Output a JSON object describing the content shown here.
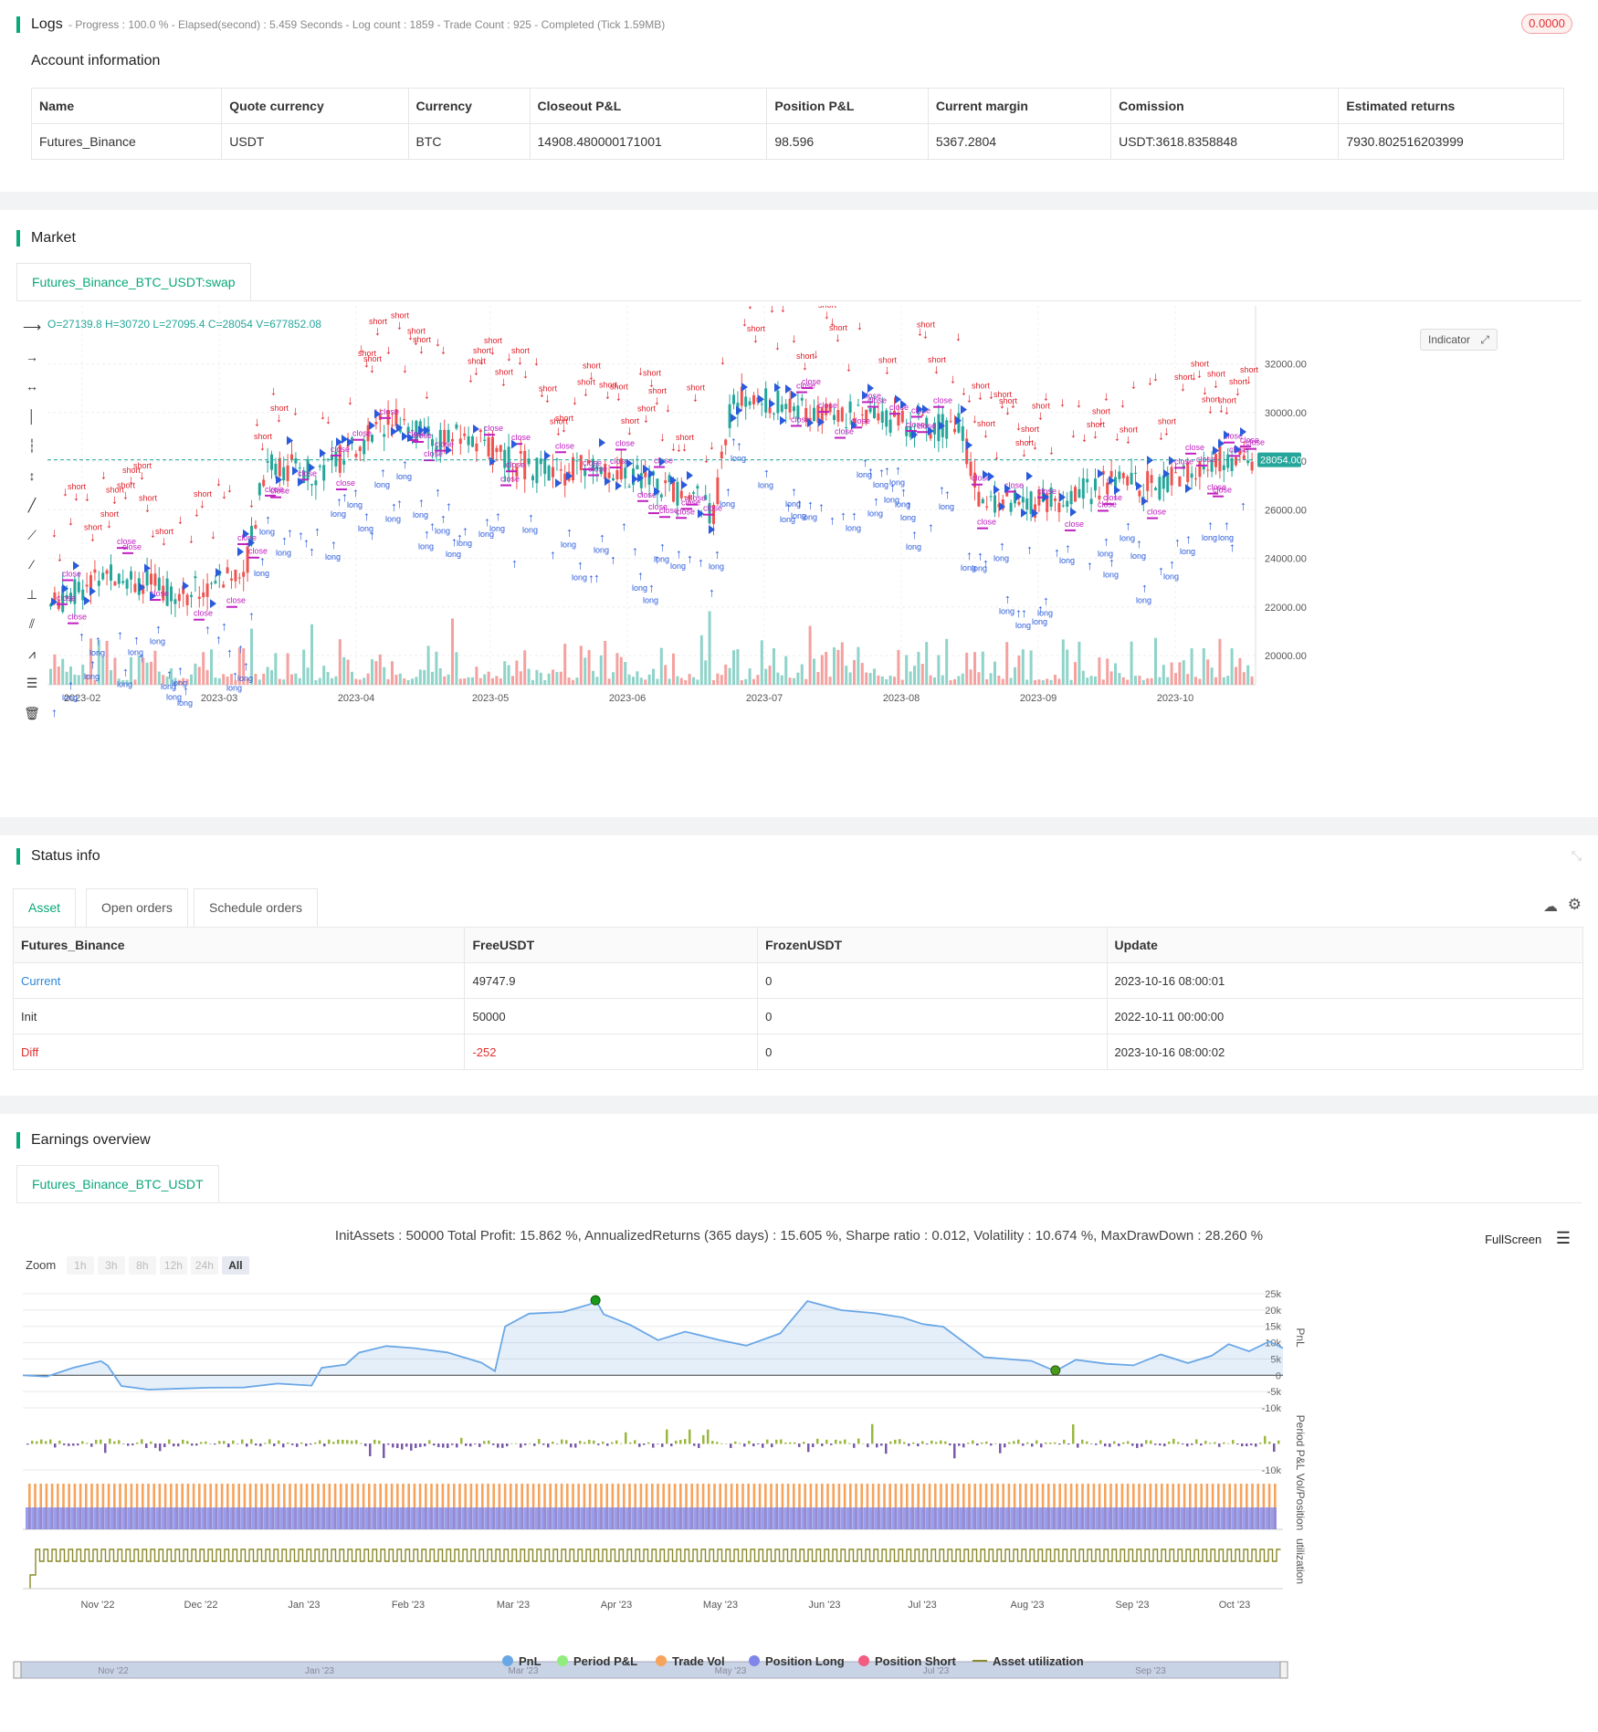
{
  "logs": {
    "title": "Logs",
    "summary": "- Progress : 100.0 % - Elapsed(second) : 5.459 Seconds - Log count : 1859 - Trade Count : 925 - Completed (Tick 1.59MB)",
    "badge": "0.0000"
  },
  "account": {
    "heading": "Account information",
    "columns": [
      "Name",
      "Quote currency",
      "Currency",
      "Closeout P&L",
      "Position P&L",
      "Current margin",
      "Comission",
      "Estimated returns"
    ],
    "row": [
      "Futures_Binance",
      "USDT",
      "BTC",
      "14908.480000171001",
      "98.596",
      "5367.2804",
      "USDT:3618.8358848",
      "7930.802516203999"
    ]
  },
  "market": {
    "title": "Market",
    "tab": "Futures_Binance_BTC_USDT:swap",
    "ohlc": "O=27139.8 H=30720 L=27095.4 C=28054 V=677852.08",
    "indicator_btn": "Indicator",
    "price_tag": "28054.00",
    "y_ticks": [
      "32000.00",
      "30000.00",
      "28000.00",
      "26000.00",
      "24000.00",
      "22000.00",
      "20000.00"
    ],
    "x_ticks": [
      "2023-02",
      "2023-03",
      "2023-04",
      "2023-05",
      "2023-06",
      "2023-07",
      "2023-08",
      "2023-09",
      "2023-10"
    ]
  },
  "status": {
    "title": "Status info",
    "tabs": [
      "Asset",
      "Open orders",
      "Schedule orders"
    ],
    "columns": [
      "Futures_Binance",
      "FreeUSDT",
      "FrozenUSDT",
      "Update"
    ],
    "rows": [
      [
        "Current",
        "49747.9",
        "0",
        "2023-10-16 08:00:01"
      ],
      [
        "Init",
        "50000",
        "0",
        "2022-10-11 00:00:00"
      ],
      [
        "Diff",
        "-252",
        "0",
        "2023-10-16 08:00:02"
      ]
    ]
  },
  "earnings": {
    "title": "Earnings overview",
    "tab": "Futures_Binance_BTC_USDT",
    "summary": "InitAssets : 50000 Total Profit: 15.862 %, AnnualizedReturns (365 days) : 15.605 %, Sharpe ratio : 0.012, Volatility : 10.674 %, MaxDrawDown : 28.260 %",
    "fullscreen": "FullScreen",
    "zoom_label": "Zoom",
    "zoom": [
      "1h",
      "3h",
      "8h",
      "12h",
      "24h",
      "All"
    ],
    "pnl_ticks": [
      "25k",
      "20k",
      "15k",
      "10k",
      "5k",
      "0",
      "-5k",
      "-10k"
    ],
    "period_tick": "-10k",
    "axis_labels": [
      "PnL",
      "Period P&L",
      "Vol/Position",
      "utilization"
    ],
    "x_ticks": [
      "Nov '22",
      "Dec '22",
      "Jan '23",
      "Feb '23",
      "Mar '23",
      "Apr '23",
      "May '23",
      "Jun '23",
      "Jul '23",
      "Aug '23",
      "Sep '23",
      "Oct '23"
    ],
    "nav_ticks": [
      "Nov '22",
      "Jan '23",
      "Mar '23",
      "May '23",
      "Jul '23",
      "Sep '23"
    ],
    "legend": [
      {
        "label": "PnL",
        "color": "#6aa7e6"
      },
      {
        "label": "Period P&L",
        "color": "#90ed7d"
      },
      {
        "label": "Trade Vol",
        "color": "#f7a35c"
      },
      {
        "label": "Position Long",
        "color": "#8085e9"
      },
      {
        "label": "Position Short",
        "color": "#f15c80"
      },
      {
        "label": "Asset utilization",
        "color": "#8a8a2a"
      }
    ]
  }
}
